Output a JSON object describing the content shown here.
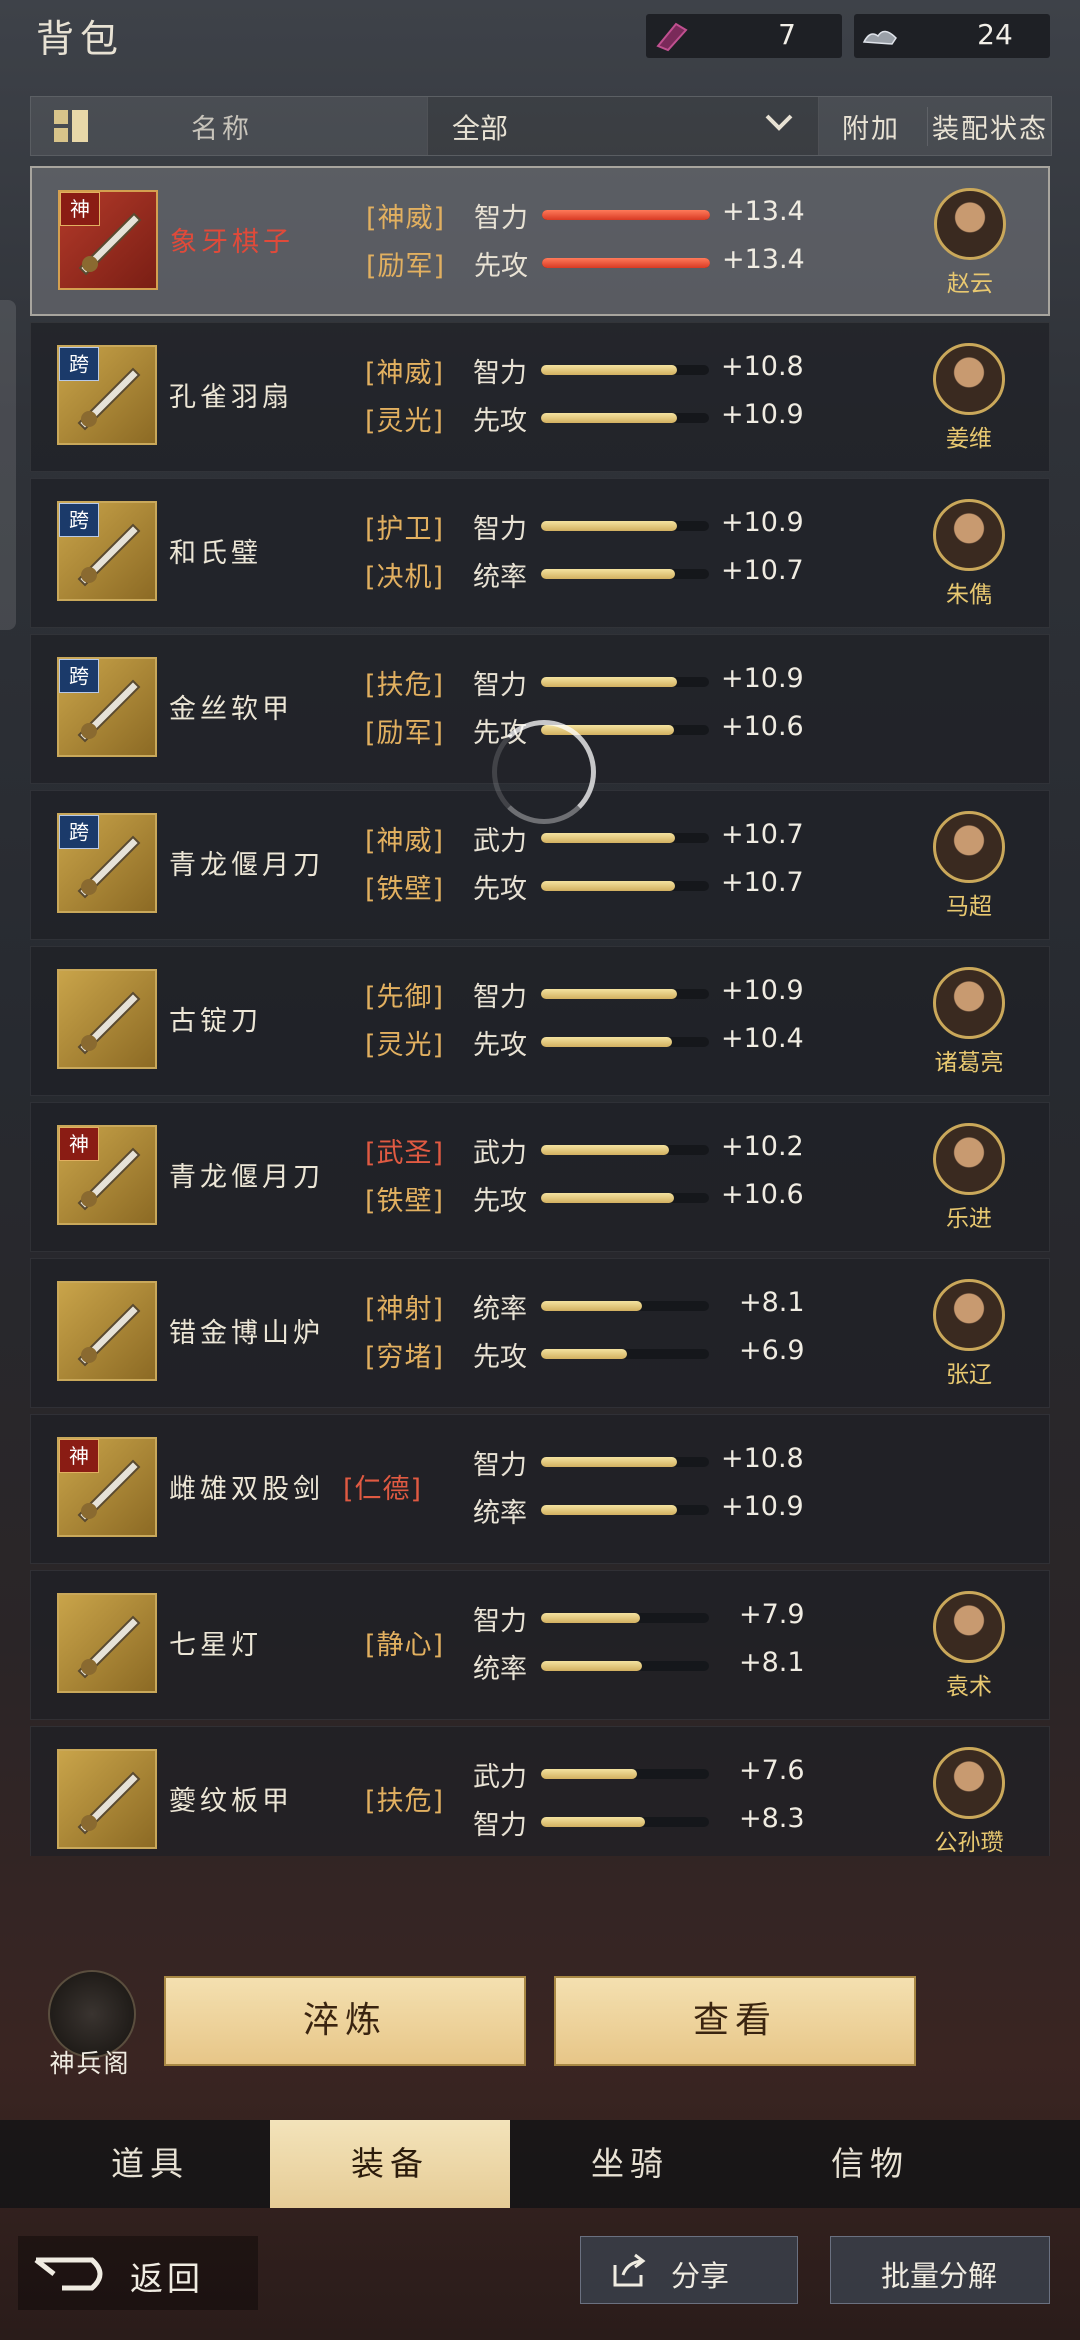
{
  "header": {
    "title": "背包",
    "gem_count": "7",
    "cloud_count": "24"
  },
  "filter": {
    "name_label": "名称",
    "category": "全部",
    "extra_label": "附加",
    "status_label": "装配状态"
  },
  "items": [
    {
      "name": "象牙棋子",
      "badge": "神",
      "attrs": [
        {
          "tag": "[神威]",
          "stat": "智力",
          "value": "+13.4",
          "level": 1.0
        },
        {
          "tag": "[励军]",
          "stat": "先攻",
          "value": "+13.4",
          "level": 1.0
        }
      ],
      "hero": "赵云"
    },
    {
      "name": "孔雀羽扇",
      "badge": "跨",
      "attrs": [
        {
          "tag": "[神威]",
          "stat": "智力",
          "value": "+10.8",
          "level": 0.81
        },
        {
          "tag": "[灵光]",
          "stat": "先攻",
          "value": "+10.9",
          "level": 0.81
        }
      ],
      "hero": "姜维"
    },
    {
      "name": "和氏璧",
      "badge": "跨",
      "attrs": [
        {
          "tag": "[护卫]",
          "stat": "智力",
          "value": "+10.9",
          "level": 0.81
        },
        {
          "tag": "[决机]",
          "stat": "统率",
          "value": "+10.7",
          "level": 0.8
        }
      ],
      "hero": "朱儁"
    },
    {
      "name": "金丝软甲",
      "badge": "跨",
      "attrs": [
        {
          "tag": "[扶危]",
          "stat": "智力",
          "value": "+10.9",
          "level": 0.81
        },
        {
          "tag": "[励军]",
          "stat": "先攻",
          "value": "+10.6",
          "level": 0.79
        }
      ],
      "hero": ""
    },
    {
      "name": "青龙偃月刀",
      "badge": "跨",
      "attrs": [
        {
          "tag": "[神威]",
          "stat": "武力",
          "value": "+10.7",
          "level": 0.8
        },
        {
          "tag": "[铁壁]",
          "stat": "先攻",
          "value": "+10.7",
          "level": 0.8
        }
      ],
      "hero": "马超"
    },
    {
      "name": "古锭刀",
      "badge": "",
      "attrs": [
        {
          "tag": "[先御]",
          "stat": "智力",
          "value": "+10.9",
          "level": 0.81
        },
        {
          "tag": "[灵光]",
          "stat": "先攻",
          "value": "+10.4",
          "level": 0.78
        }
      ],
      "hero": "诸葛亮"
    },
    {
      "name": "青龙偃月刀",
      "badge": "神",
      "attrs": [
        {
          "tag": "[武圣]",
          "stat": "武力",
          "value": "+10.2",
          "level": 0.76,
          "red": true
        },
        {
          "tag": "[铁壁]",
          "stat": "先攻",
          "value": "+10.6",
          "level": 0.79
        }
      ],
      "hero": "乐进"
    },
    {
      "name": "错金博山炉",
      "badge": "",
      "attrs": [
        {
          "tag": "[神射]",
          "stat": "统率",
          "value": "+8.1",
          "level": 0.6
        },
        {
          "tag": "[穷堵]",
          "stat": "先攻",
          "value": "+6.9",
          "level": 0.51
        }
      ],
      "hero": "张辽"
    },
    {
      "name": "雌雄双股剑",
      "badge": "神",
      "tag_single": "[仁德]",
      "attrs": [
        {
          "tag": "",
          "stat": "智力",
          "value": "+10.8",
          "level": 0.81
        },
        {
          "tag": "",
          "stat": "统率",
          "value": "+10.9",
          "level": 0.81
        }
      ],
      "hero": ""
    },
    {
      "name": "七星灯",
      "badge": "",
      "tag_single": "[静心]",
      "attrs": [
        {
          "tag": "",
          "stat": "智力",
          "value": "+7.9",
          "level": 0.59
        },
        {
          "tag": "",
          "stat": "统率",
          "value": "+8.1",
          "level": 0.6
        }
      ],
      "hero": "袁术"
    },
    {
      "name": "夔纹板甲",
      "badge": "",
      "tag_single": "[扶危]",
      "attrs": [
        {
          "tag": "",
          "stat": "武力",
          "value": "+7.6",
          "level": 0.57
        },
        {
          "tag": "",
          "stat": "智力",
          "value": "+8.3",
          "level": 0.62
        }
      ],
      "hero": "公孙瓒"
    }
  ],
  "actions": {
    "armory": "神兵阁",
    "refine": "淬炼",
    "view": "查看"
  },
  "tabs": [
    "道具",
    "装备",
    "坐骑",
    "信物"
  ],
  "footer": {
    "back": "返回",
    "share": "分享",
    "batch": "批量分解"
  },
  "colors": {
    "accent_gold": "#e2b060",
    "selected_tab": "#f3e3ba",
    "red_rarity": "#e04a3a"
  }
}
